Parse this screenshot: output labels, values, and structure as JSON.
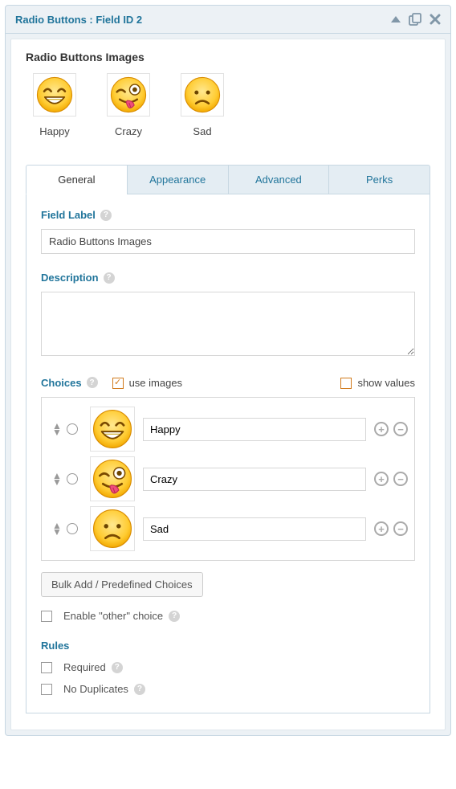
{
  "header": {
    "title": "Radio Buttons : Field ID 2"
  },
  "field_name": "Radio Buttons Images",
  "preview": {
    "items": [
      {
        "label": "Happy"
      },
      {
        "label": "Crazy"
      },
      {
        "label": "Sad"
      }
    ]
  },
  "tabs": {
    "general": "General",
    "appearance": "Appearance",
    "advanced": "Advanced",
    "perks": "Perks"
  },
  "labels": {
    "field_label": "Field Label",
    "description": "Description",
    "choices": "Choices",
    "use_images": "use images",
    "show_values": "show values",
    "bulk_add": "Bulk Add / Predefined Choices",
    "enable_other": "Enable \"other\" choice",
    "rules": "Rules",
    "required": "Required",
    "no_duplicates": "No Duplicates"
  },
  "values": {
    "field_label": "Radio Buttons Images",
    "description": "",
    "use_images_checked": true,
    "show_values_checked": false,
    "enable_other_checked": false,
    "required_checked": false,
    "no_duplicates_checked": false
  },
  "choices": [
    {
      "label": "Happy"
    },
    {
      "label": "Crazy"
    },
    {
      "label": "Sad"
    }
  ]
}
